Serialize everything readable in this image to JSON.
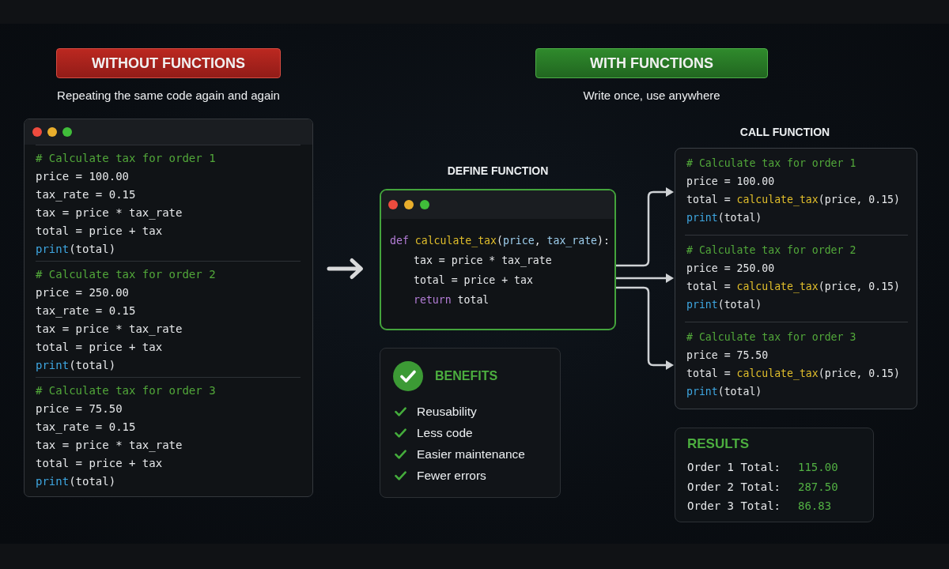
{
  "without_functions": {
    "badge": "WITHOUT FUNCTIONS",
    "subtitle": "Repeating the same code again and again",
    "code_window": {
      "blocks": [
        {
          "lines": [
            {
              "tokens": [
                {
                  "text": "# Calculate tax for order 1",
                  "kind": "comment"
                }
              ]
            },
            {
              "tokens": [
                {
                  "text": "price = 100.00",
                  "kind": "plain"
                }
              ]
            },
            {
              "tokens": [
                {
                  "text": "tax_rate = 0.15",
                  "kind": "plain"
                }
              ]
            },
            {
              "tokens": [
                {
                  "text": "tax = price * tax_rate",
                  "kind": "plain"
                }
              ]
            },
            {
              "tokens": [
                {
                  "text": "total = price + tax",
                  "kind": "plain"
                }
              ]
            },
            {
              "tokens": [
                {
                  "text": "print",
                  "kind": "builtin"
                },
                {
                  "text": "(total)",
                  "kind": "plain"
                }
              ]
            }
          ]
        },
        {
          "lines": [
            {
              "tokens": [
                {
                  "text": "# Calculate tax for order 2",
                  "kind": "comment"
                }
              ]
            },
            {
              "tokens": [
                {
                  "text": "price = 250.00",
                  "kind": "plain"
                }
              ]
            },
            {
              "tokens": [
                {
                  "text": "tax_rate = 0.15",
                  "kind": "plain"
                }
              ]
            },
            {
              "tokens": [
                {
                  "text": "tax = price * tax_rate",
                  "kind": "plain"
                }
              ]
            },
            {
              "tokens": [
                {
                  "text": "total = price + tax",
                  "kind": "plain"
                }
              ]
            },
            {
              "tokens": [
                {
                  "text": "print",
                  "kind": "builtin"
                },
                {
                  "text": "(total)",
                  "kind": "plain"
                }
              ]
            }
          ]
        },
        {
          "lines": [
            {
              "tokens": [
                {
                  "text": "# Calculate tax for order 3",
                  "kind": "comment"
                }
              ]
            },
            {
              "tokens": [
                {
                  "text": "price = 75.50",
                  "kind": "plain"
                }
              ]
            },
            {
              "tokens": [
                {
                  "text": "tax_rate = 0.15",
                  "kind": "plain"
                }
              ]
            },
            {
              "tokens": [
                {
                  "text": "tax = price * tax_rate",
                  "kind": "plain"
                }
              ]
            },
            {
              "tokens": [
                {
                  "text": "total = price + tax",
                  "kind": "plain"
                }
              ]
            },
            {
              "tokens": [
                {
                  "text": "print",
                  "kind": "builtin"
                },
                {
                  "text": "(total)",
                  "kind": "plain"
                }
              ]
            }
          ]
        }
      ]
    }
  },
  "with_functions": {
    "badge": "WITH FUNCTIONS",
    "subtitle": "Write once, use anywhere",
    "define": {
      "heading": "DEFINE FUNCTION",
      "code_window": {
        "lines": [
          {
            "tokens": [
              {
                "text": "def ",
                "kind": "keyword"
              },
              {
                "text": "calculate_tax",
                "kind": "function"
              },
              {
                "text": "(",
                "kind": "plain"
              },
              {
                "text": "price",
                "kind": "param"
              },
              {
                "text": ", ",
                "kind": "plain"
              },
              {
                "text": "tax_rate",
                "kind": "param"
              },
              {
                "text": "):",
                "kind": "plain"
              }
            ],
            "children": [
              {
                "tokens": [
                  {
                    "text": "tax = price * tax_rate",
                    "kind": "plain"
                  }
                ]
              },
              {
                "tokens": [
                  {
                    "text": "total = price + tax",
                    "kind": "plain"
                  }
                ]
              },
              {
                "tokens": [
                  {
                    "text": "return ",
                    "kind": "keyword"
                  },
                  {
                    "text": "total",
                    "kind": "plain"
                  }
                ]
              }
            ]
          }
        ]
      }
    },
    "benefits": {
      "title": "BENEFITS",
      "items": [
        "Reusability",
        "Less code",
        "Easier maintenance",
        "Fewer errors"
      ]
    },
    "call": {
      "heading": "CALL FUNCTION",
      "blocks": [
        {
          "lines": [
            {
              "tokens": [
                {
                  "text": "# Calculate tax for order 1",
                  "kind": "comment"
                }
              ]
            },
            {
              "tokens": [
                {
                  "text": "price = 100.00",
                  "kind": "plain"
                }
              ]
            },
            {
              "tokens": [
                {
                  "text": "total = ",
                  "kind": "plain"
                },
                {
                  "text": "calculate_tax",
                  "kind": "function"
                },
                {
                  "text": "(price, 0.15)",
                  "kind": "plain"
                }
              ]
            },
            {
              "tokens": [
                {
                  "text": "print",
                  "kind": "builtin"
                },
                {
                  "text": "(total)",
                  "kind": "plain"
                }
              ]
            }
          ]
        },
        {
          "lines": [
            {
              "tokens": [
                {
                  "text": "# Calculate tax for order 2",
                  "kind": "comment"
                }
              ]
            },
            {
              "tokens": [
                {
                  "text": "price = 250.00",
                  "kind": "plain"
                }
              ]
            },
            {
              "tokens": [
                {
                  "text": "total = ",
                  "kind": "plain"
                },
                {
                  "text": "calculate_tax",
                  "kind": "function"
                },
                {
                  "text": "(price, 0.15)",
                  "kind": "plain"
                }
              ]
            },
            {
              "tokens": [
                {
                  "text": "print",
                  "kind": "builtin"
                },
                {
                  "text": "(total)",
                  "kind": "plain"
                }
              ]
            }
          ]
        },
        {
          "lines": [
            {
              "tokens": [
                {
                  "text": "# Calculate tax for order 3",
                  "kind": "comment"
                }
              ]
            },
            {
              "tokens": [
                {
                  "text": "price = 75.50",
                  "kind": "plain"
                }
              ]
            },
            {
              "tokens": [
                {
                  "text": "total = ",
                  "kind": "plain"
                },
                {
                  "text": "calculate_tax",
                  "kind": "function"
                },
                {
                  "text": "(price, 0.15)",
                  "kind": "plain"
                }
              ]
            },
            {
              "tokens": [
                {
                  "text": "print",
                  "kind": "builtin"
                },
                {
                  "text": "(total)",
                  "kind": "plain"
                }
              ]
            }
          ]
        }
      ]
    },
    "results": {
      "title": "RESULTS",
      "rows": [
        {
          "label": "Order 1 Total:",
          "value": "115.00"
        },
        {
          "label": "Order 2 Total:",
          "value": "287.50"
        },
        {
          "label": "Order 3 Total:",
          "value": "86.83"
        }
      ]
    }
  }
}
